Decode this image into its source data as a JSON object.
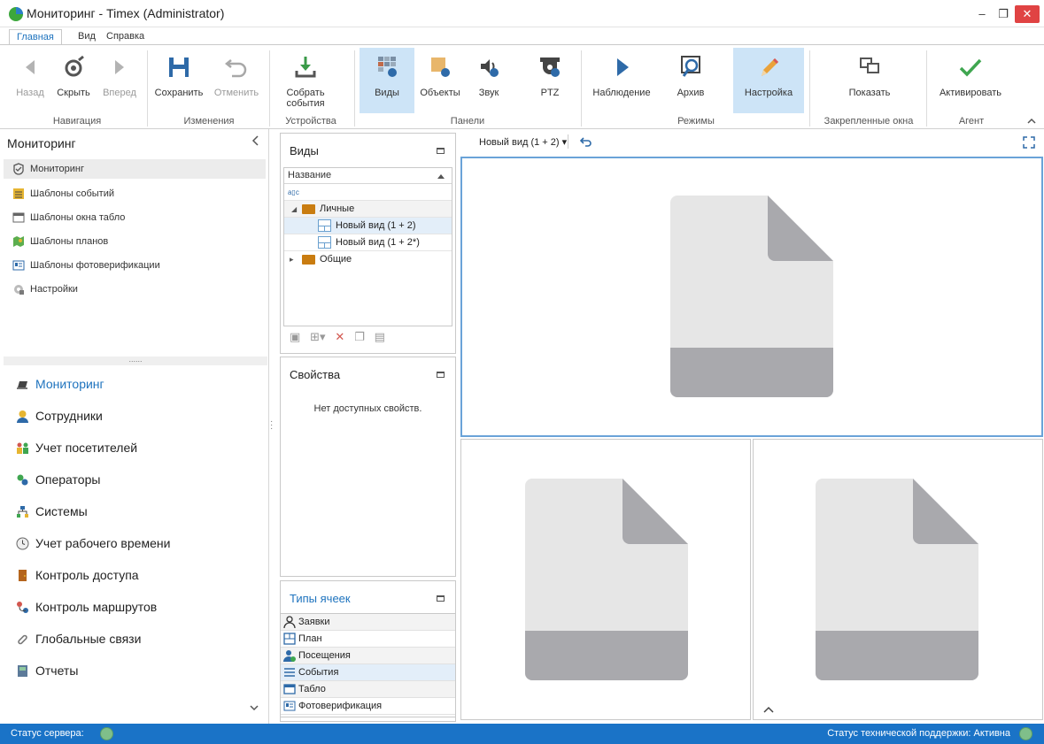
{
  "window": {
    "title": "Мониторинг - Timex (Administrator)",
    "controls": [
      "–",
      "❐",
      "✕"
    ]
  },
  "menu": {
    "tabs": [
      "Главная",
      "Вид",
      "Справка"
    ],
    "active": "Главная"
  },
  "ribbon": {
    "buttons": {
      "back": "Назад",
      "hide": "Скрыть",
      "forward": "Вперед",
      "save": "Сохранить",
      "cancel": "Отменить",
      "collect_events": "Собрать события",
      "views": "Виды",
      "objects": "Объекты",
      "sound": "Звук",
      "ptz": "PTZ",
      "observation": "Наблюдение",
      "archive": "Архив",
      "settings": "Настройка",
      "show": "Показать",
      "activate": "Активировать"
    },
    "groups": {
      "navigation": "Навигация",
      "changes": "Изменения",
      "devices": "Устройства",
      "panels": "Панели",
      "modes": "Режимы",
      "pinned": "Закрепленные окна",
      "agent": "Агент"
    },
    "active_buttons": [
      "Виды",
      "Настройка"
    ],
    "collapse_icon": "chevron-up-icon"
  },
  "left_panel": {
    "header": "Мониторинг",
    "collapse_icon": "chevron-left-icon",
    "tree": [
      {
        "label": "Мониторинг",
        "icon": "shield-check-icon",
        "selected": true
      },
      {
        "label": "Шаблоны событий",
        "icon": "list-icon"
      },
      {
        "label": "Шаблоны окна табло",
        "icon": "board-icon"
      },
      {
        "label": "Шаблоны планов",
        "icon": "map-icon"
      },
      {
        "label": "Шаблоны фотоверификации",
        "icon": "id-card-icon"
      },
      {
        "label": "Настройки",
        "icon": "settings-icon"
      }
    ],
    "splitter": "......",
    "nav": [
      {
        "label": "Мониторинг",
        "icon": "monitoring-icon",
        "active": true
      },
      {
        "label": "Сотрудники",
        "icon": "employees-icon"
      },
      {
        "label": "Учет посетителей",
        "icon": "visitors-icon"
      },
      {
        "label": "Операторы",
        "icon": "operators-icon"
      },
      {
        "label": "Системы",
        "icon": "systems-icon"
      },
      {
        "label": "Учет рабочего времени",
        "icon": "clock-icon"
      },
      {
        "label": "Контроль доступа",
        "icon": "door-icon"
      },
      {
        "label": "Контроль маршрутов",
        "icon": "route-icon"
      },
      {
        "label": "Глобальные связи",
        "icon": "link-icon"
      },
      {
        "label": "Отчеты",
        "icon": "reports-icon"
      }
    ],
    "more_icon": "chevron-down-icon"
  },
  "views_panel": {
    "title": "Виды",
    "column": "Название",
    "filter_icon": "abc-filter-icon",
    "tree": {
      "personal": "Личные",
      "personal_items": [
        "Новый вид (1 + 2)",
        "Новый вид (1 + 2*)"
      ],
      "common": "Общие"
    }
  },
  "properties_panel": {
    "title": "Свойства",
    "empty": "Нет доступных свойств."
  },
  "cell_types_panel": {
    "title": "Типы ячеек",
    "items": [
      "Заявки",
      "План",
      "Посещения",
      "События",
      "Табло",
      "Фотоверификация"
    ]
  },
  "view_toolbar": {
    "selected_view": "Новый вид (1 + 2) ▾",
    "undo_icon": "undo-icon",
    "expand_icon": "expand-icon"
  },
  "status_bar": {
    "server_status": "Статус сервера:",
    "support_status": "Статус технической поддержки: Активна"
  },
  "colors": {
    "accent": "#1e73be",
    "statusbar": "#1a73c7",
    "active_button": "#cde4f7",
    "close_button": "#e04343"
  }
}
